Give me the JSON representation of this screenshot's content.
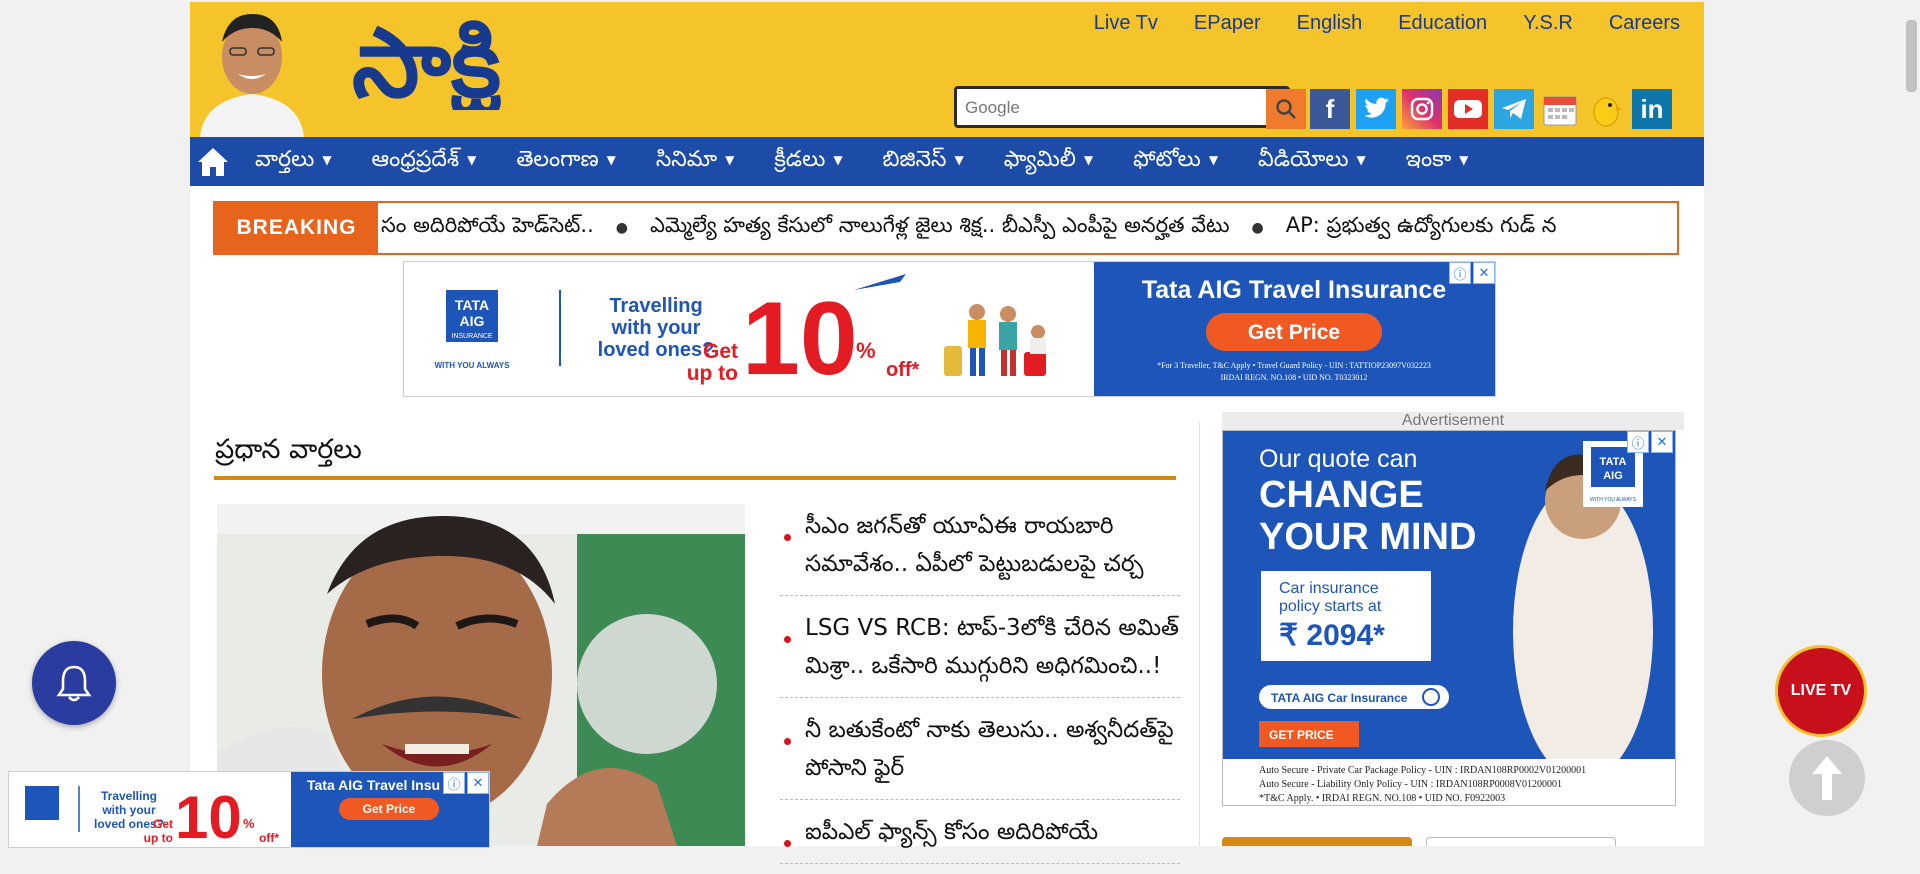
{
  "colors": {
    "masthead": "#f5c32a",
    "nav": "#1c4ba8",
    "breaking": "#e7641c",
    "accent_rule": "#d58913"
  },
  "brand": {
    "logo_text": "సాక్షి"
  },
  "top_links": [
    "Live Tv",
    "EPaper",
    "English",
    "Education",
    "Y.S.R",
    "Careers"
  ],
  "search": {
    "value": "Google"
  },
  "social": [
    "facebook-icon",
    "twitter-icon",
    "instagram-icon",
    "youtube-icon",
    "telegram-icon",
    "calendar-icon",
    "koo-icon",
    "linkedin-icon"
  ],
  "nav": {
    "items": [
      "వార్తలు",
      "ఆంధ్రప్రదేశ్",
      "తెలంగాణ",
      "సినిమా",
      "క్రీడలు",
      "బిజినెస్",
      "ఫ్యామిలీ",
      "ఫోటోలు",
      "వీడియోలు",
      "ఇంకా"
    ]
  },
  "breaking": {
    "label": "BREAKING",
    "items": [
      "సం అదిరిపోయే హెడ్‌సెట్..",
      "ఎమ్మెల్యే హత్య కేసులో నాలుగేళ్ల జైలు శిక్ష.. బీఎస్పీ ఎంపీపై అనర్హత వేటు",
      "AP: ప్రభుత్వ ఉద్యోగులకు గుడ్ న"
    ]
  },
  "ad_top": {
    "brand1": "TATA",
    "brand2": "AIG",
    "brand3": "INSURANCE",
    "tag": "WITH YOU ALWAYS",
    "line1": "Travelling",
    "line2": "with your",
    "line3": "loved ones?",
    "get": "Get",
    "upto": "up to",
    "pct": "10",
    "pct2": "%",
    "off": "off*",
    "headline": "Tata AIG Travel Insurance",
    "cta": "Get Price",
    "fine1": "*For 3 Traveller, T&C Apply • Travel Guard Policy - UIN : TATTIOP23097V032223",
    "fine2": "IRDAI REGN. NO.108 • UID NO. T0323012"
  },
  "section": {
    "title": "ప్రధాన వార్తలు"
  },
  "headlines": [
    "సీఎం జగన్‌తో యూఏఈ రాయబారి సమావేశం.. ఏపీలో పెట్టుబడులపై చర్చ",
    "LSG VS RCB: టాప్‌-3లోకి చేరిన అమిత్‌ మిశ్రా.. ఒకేసారి ముగ్గురిని అధిగమించి..!",
    "నీ బతుకేంటో నాకు తెలుసు.. అశ్వనీదత్‌పై పోసాని ఫైర్‌",
    "ఐపీఎల్‌ ఫ్యాన్స్‌ కోసం అదిరిపోయే"
  ],
  "side_ad": {
    "label": "Advertisement",
    "l1": "Our quote can",
    "l2": "CHANGE",
    "l3": "YOUR MIND",
    "box1": "Car insurance",
    "box2": "policy starts at",
    "price": "₹ 2094*",
    "search": "TATA AIG Car Insurance",
    "cta": "GET PRICE",
    "f1": "Auto Secure - Private Car Package Policy - UIN : IRDAN108RP0002V01200001",
    "f2": "Auto Secure - Liability Only Policy - UIN : IRDAN108RP0008V01200001",
    "f3": "*T&C Apply.  •  IRDAI REGN. NO.108  •  UID NO. F0922003",
    "brand": "TATA",
    "brand2": "AIG",
    "tag": "WITH YOU ALWAYS"
  },
  "float": {
    "livetv": "LIVE TV"
  },
  "ad_bottom": {
    "line1": "Travelling",
    "line2": "with your",
    "line3": "loved ones?",
    "headline": "Tata AIG Travel Insu",
    "cta": "Get Price",
    "get": "Get",
    "upto": "up to",
    "pct": "10",
    "pct2": "%",
    "off": "off*"
  }
}
